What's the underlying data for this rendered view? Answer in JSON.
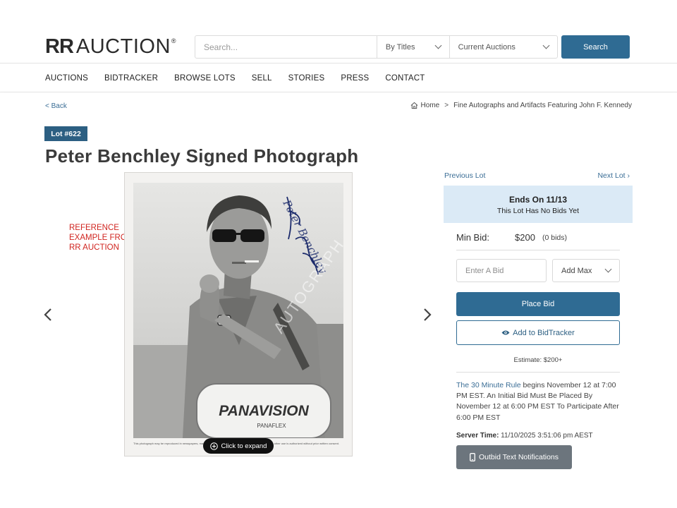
{
  "logo": {
    "bold": "RR",
    "light": "AUCTION",
    "reg": "®"
  },
  "search": {
    "placeholder": "Search...",
    "filter_by": "By Titles",
    "filter_auction": "Current Auctions",
    "button": "Search"
  },
  "nav": {
    "items": [
      "AUCTIONS",
      "BIDTRACKER",
      "BROWSE LOTS",
      "SELL",
      "STORIES",
      "PRESS",
      "CONTACT"
    ]
  },
  "breadcrumb": {
    "back": "< Back",
    "home": "Home",
    "separator": ">",
    "current": "Fine Autographs and Artifacts Featuring John F. Kennedy"
  },
  "lot": {
    "badge": "Lot #622",
    "title": "Peter Benchley Signed Photograph"
  },
  "photo": {
    "reference_note": [
      "REFERENCE",
      "EXAMPLE FROM",
      "RR AUCTION"
    ],
    "watermark": "AUTOGRAPH",
    "signature": "Peter Benchley",
    "sign_text": "PANAVISION",
    "sign_sub": "PANAFLEX",
    "caption": "This photograph may be reproduced in newspapers, magazines and on television for publicity purposes only. No other use is authorized without prior written consent.",
    "expand_label": "Click to expand"
  },
  "panel": {
    "prev_lot": "Previous Lot",
    "next_lot": "Next Lot",
    "next_arrow": "›",
    "ends_title": "Ends On 11/13",
    "ends_sub": "This Lot Has No Bids Yet",
    "min_bid_label": "Min Bid:",
    "min_bid_value": "$200",
    "min_bid_count": "(0 bids)",
    "bid_placeholder": "Enter A Bid",
    "add_max": "Add Max",
    "place_bid": "Place Bid",
    "bidtracker": "Add to BidTracker",
    "estimate": "Estimate: $200+",
    "rule_link": "The 30 Minute Rule",
    "rule_text": " begins November 12 at 7:00 PM EST. An Initial Bid Must Be Placed By November 12 at 6:00 PM EST To Participate After 6:00 PM EST",
    "server_time_label": "Server Time:",
    "server_time_value": " 11/10/2025 3:51:06 pm AEST",
    "outbid_button": "Outbid Text Notifications"
  },
  "colors": {
    "accent": "#2f6b93",
    "badge": "#2c5f82",
    "link": "#3b6e96",
    "ends_bg": "#dbeaf6",
    "reference_red": "#d0241f",
    "outbid_gray": "#6c757d"
  }
}
